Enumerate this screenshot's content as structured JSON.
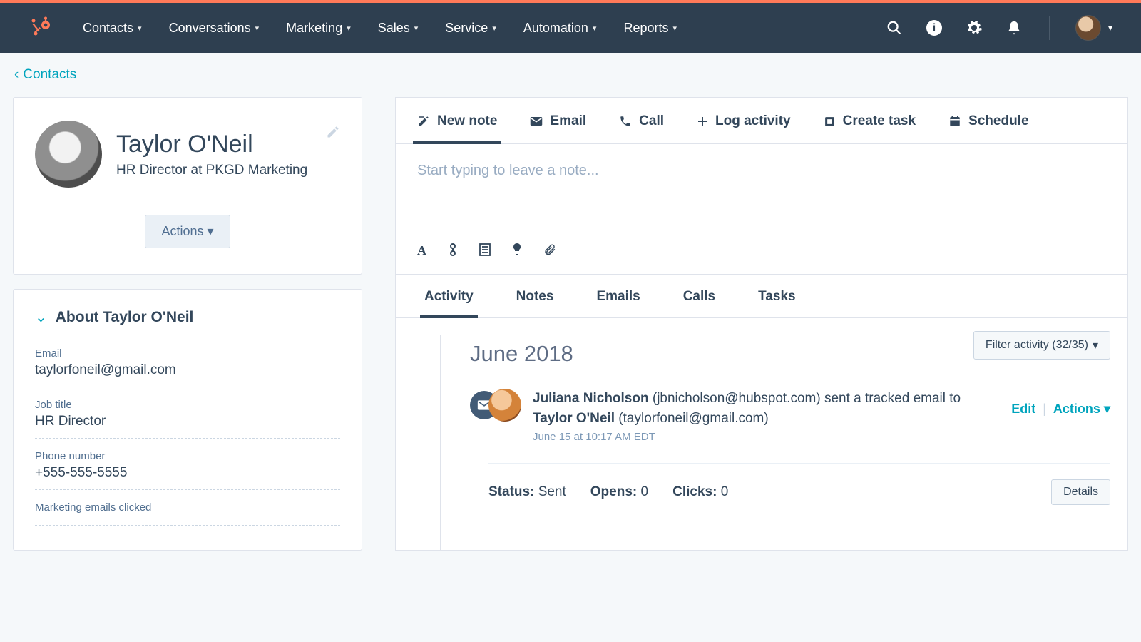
{
  "nav": {
    "items": [
      "Contacts",
      "Conversations",
      "Marketing",
      "Sales",
      "Service",
      "Automation",
      "Reports"
    ]
  },
  "breadcrumb": {
    "label": "Contacts"
  },
  "profile": {
    "name": "Taylor O'Neil",
    "subtitle": "HR Director at PKGD Marketing",
    "actions_label": "Actions"
  },
  "about": {
    "title": "About Taylor O'Neil",
    "fields": [
      {
        "label": "Email",
        "value": "taylorfoneil@gmail.com"
      },
      {
        "label": "Job title",
        "value": "HR Director"
      },
      {
        "label": "Phone number",
        "value": "+555-555-5555"
      },
      {
        "label": "Marketing emails clicked",
        "value": ""
      }
    ]
  },
  "compose": {
    "tabs": [
      "New note",
      "Email",
      "Call",
      "Log activity",
      "Create task",
      "Schedule"
    ],
    "placeholder": "Start typing to leave a note..."
  },
  "activity_tabs": [
    "Activity",
    "Notes",
    "Emails",
    "Calls",
    "Tasks"
  ],
  "filter": {
    "label": "Filter activity (32/35)"
  },
  "timeline": {
    "month": "June 2018",
    "item": {
      "sender_name": "Juliana Nicholson",
      "sender_email": "jbnicholson@hubspot.com",
      "action_text": "sent a tracked email to",
      "recipient_name": "Taylor O'Neil",
      "recipient_email": "taylorfoneil@gmail.com",
      "timestamp": "June 15 at 10:17 AM EDT",
      "status_label": "Status:",
      "status_value": "Sent",
      "opens_label": "Opens:",
      "opens_value": "0",
      "clicks_label": "Clicks:",
      "clicks_value": "0",
      "edit": "Edit",
      "actions": "Actions",
      "details": "Details"
    }
  }
}
